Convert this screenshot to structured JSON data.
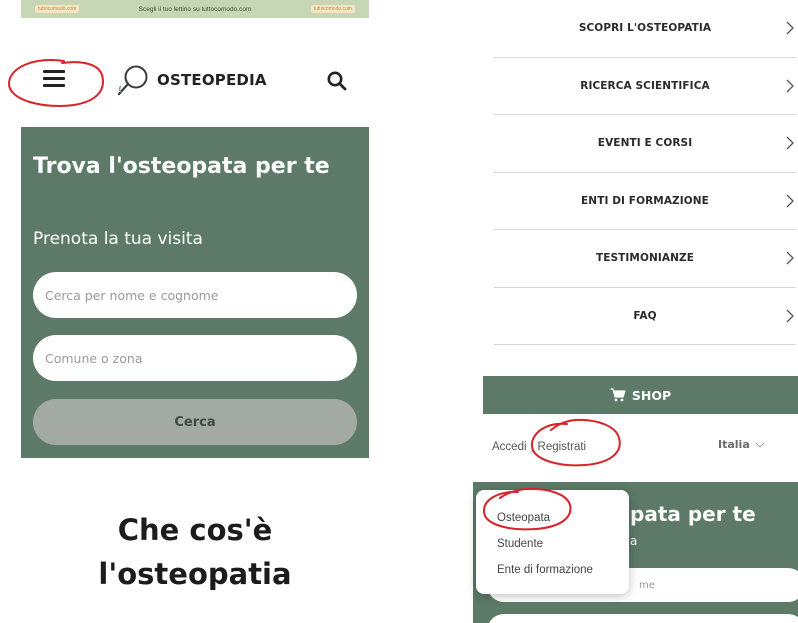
{
  "ad_banner": {
    "logo_left": "tuttocomodo.com",
    "text": "Scegli il tuo lettino su tuttocomodo.com",
    "logo_right": "tuttocomodo.com"
  },
  "header": {
    "brand": "OSTEOPEDIA"
  },
  "hero": {
    "title": "Trova l'osteopata per te",
    "subtitle": "Prenota la tua visita",
    "name_placeholder": "Cerca per nome e cognome",
    "zone_placeholder": "Comune o zona",
    "search_button": "Cerca"
  },
  "section": {
    "heading": "Che cos'è l'osteopatia"
  },
  "menu": {
    "items": [
      {
        "label": "SCOPRI L'OSTEOPATIA"
      },
      {
        "label": "RICERCA SCIENTIFICA"
      },
      {
        "label": "EVENTI E CORSI"
      },
      {
        "label": "ENTI DI FORMAZIONE"
      },
      {
        "label": "TESTIMONIANZE"
      },
      {
        "label": "FAQ"
      }
    ],
    "shop_label": "SHOP"
  },
  "account": {
    "login": "Accedi",
    "separator": "|",
    "register": "Registrati",
    "language": "Italia"
  },
  "hero_partial": {
    "title_fragment": "pata per te",
    "subtitle_fragment": "a",
    "field_fragment": "me"
  },
  "register_dropdown": {
    "options": [
      "Osteopata",
      "Studente",
      "Ente di formazione"
    ]
  },
  "colors": {
    "brand_green": "#5c7a67",
    "button_gray": "#a3aaa4",
    "annotation_red": "#d8232a"
  }
}
